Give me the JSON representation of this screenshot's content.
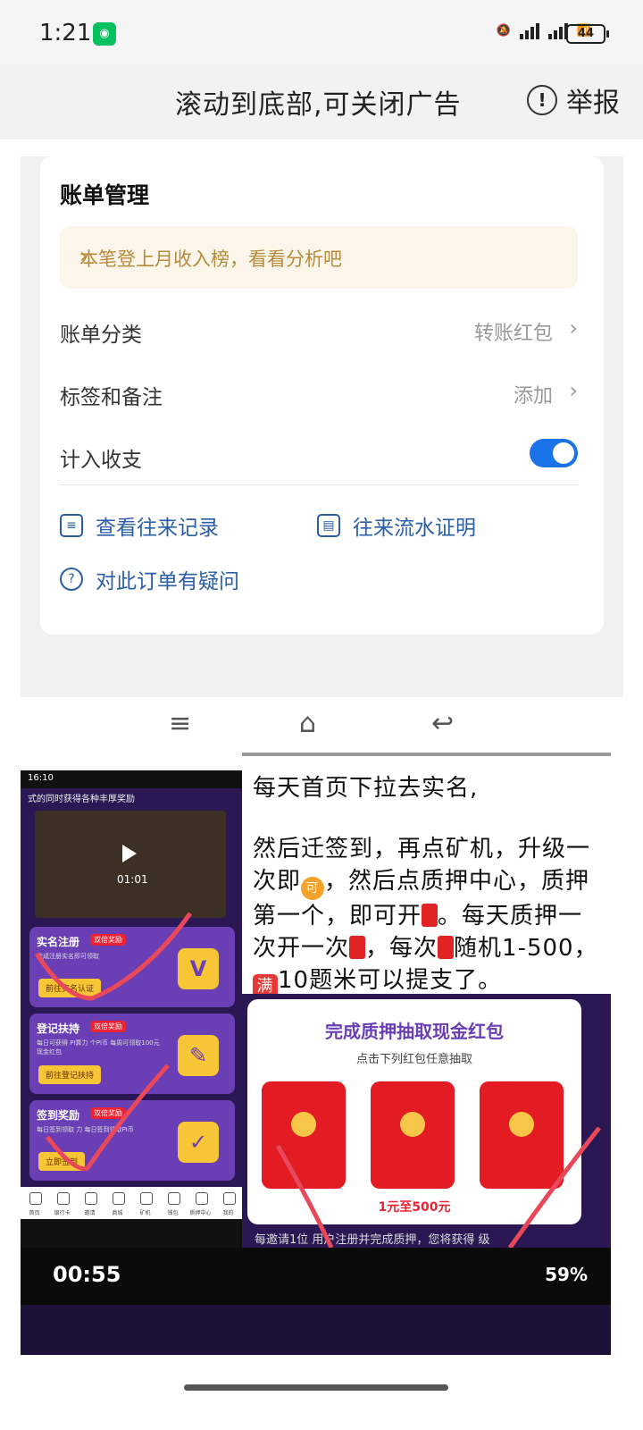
{
  "status_bar": {
    "time": "1:21",
    "battery": "44"
  },
  "ad_bar": {
    "title": "滚动到底部,可关闭广告",
    "report": "举报"
  },
  "bill": {
    "heading": "账单管理",
    "tip": "本笔登上月收入榜，看看分析吧",
    "rows": [
      {
        "label": "账单分类",
        "value": "转账红包"
      },
      {
        "label": "标签和备注",
        "value": "添加"
      },
      {
        "label": "计入收支",
        "value": ""
      }
    ],
    "links": [
      "查看往来记录",
      "往来流水证明",
      "对此订单有疑问"
    ]
  },
  "left_app": {
    "time": "16:10",
    "subtitle": "式的同时获得各种丰厚奖励",
    "video_time": "01:01",
    "tasks": [
      {
        "title": "实名注册",
        "badge": "双倍奖励",
        "desc": "完成注册实名即可领取",
        "button": "前往实名认证"
      },
      {
        "title": "登记扶持",
        "badge": "双倍奖励",
        "desc": "每日可获得 PI算力 个PI币 每周可领取100元现金红包",
        "button": "前往登记扶持"
      },
      {
        "title": "签到奖励",
        "badge": "双倍奖励",
        "desc": "每日签到领取 力 每日签到领取PI币",
        "button": "立即签到"
      }
    ],
    "tabs": [
      "首页",
      "银行卡",
      "邀请",
      "商城",
      "矿机",
      "钱包",
      "质押中心",
      "我的"
    ]
  },
  "instructions": {
    "line1": "每天首页下拉去实名,",
    "line2a": "然后迁签到，再点矿机，升级一次即",
    "line2b": "，然后点质押中心，质押第一个，即可开",
    "line2c": "。每天质押一次开一次",
    "line2d": "，每次",
    "line2e": "随机1-500，",
    "line2f": "10题米可以提支了。",
    "emoji_ke": "可",
    "emoji_man": "满"
  },
  "red_panel": {
    "title": "完成质押抽取现金红包",
    "subtitle": "点击下列红包任意抽取",
    "price": "1元至500元",
    "footer": "每邀请1位 用户注册并完成质押，您将获得 级"
  },
  "dark_status": {
    "time": "00:55",
    "battery": "59%"
  }
}
